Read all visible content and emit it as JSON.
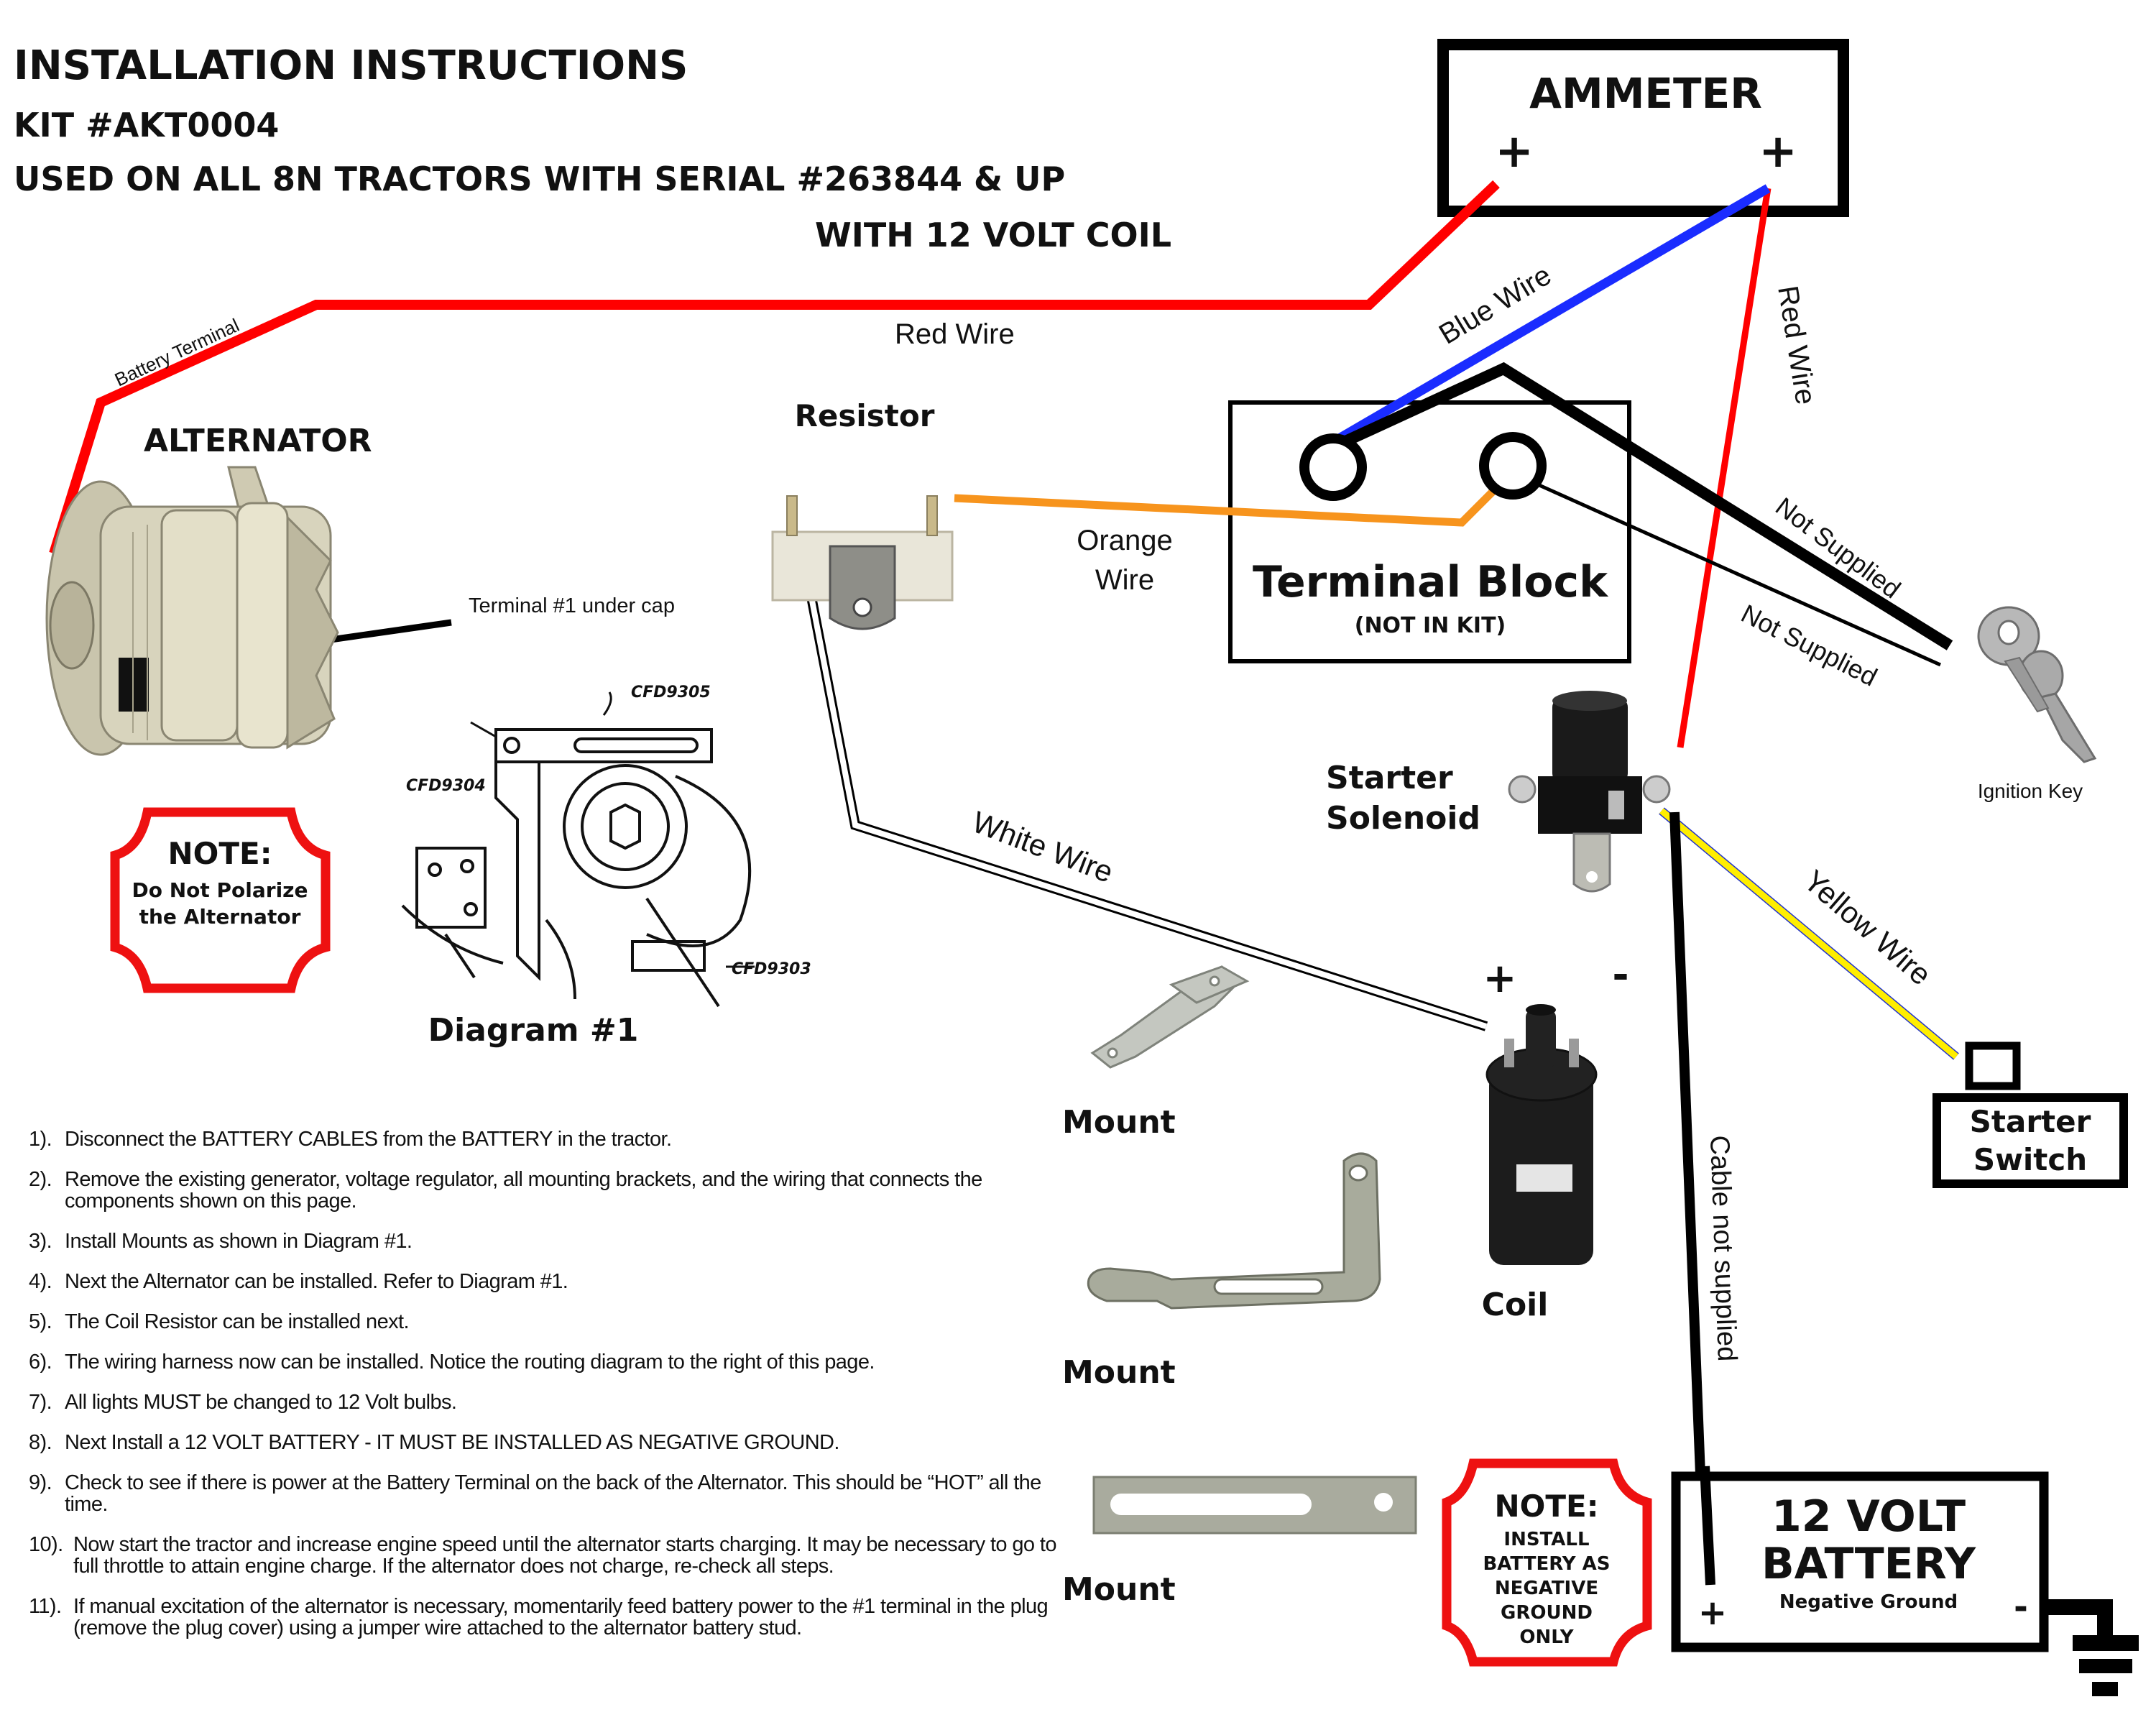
{
  "header": {
    "title": "INSTALLATION INSTRUCTIONS",
    "kit": "KIT #AKT0004",
    "applicability": "USED ON ALL 8N TRACTORS WITH SERIAL #263844 & UP",
    "coil_note": "WITH 12 VOLT COIL"
  },
  "colors": {
    "red_wire": "#ff0000",
    "blue_wire": "#1a2cff",
    "orange_wire": "#f7941d",
    "yellow_wire": "#ffee00",
    "black_wire": "#000000",
    "note_border": "#ee1111"
  },
  "components": {
    "ammeter": {
      "label": "AMMETER",
      "terminal_left": "+",
      "terminal_right": "+"
    },
    "alternator": {
      "label": "ALTERNATOR",
      "terminal_callout": "Terminal #1 under cap"
    },
    "resistor": {
      "label": "Resistor"
    },
    "terminal_block": {
      "label": "Terminal Block",
      "sublabel": "(NOT IN KIT)"
    },
    "starter_solenoid": {
      "line1": "Starter",
      "line2": "Solenoid"
    },
    "ignition_key": {
      "label": "Ignition Key"
    },
    "coil": {
      "label": "Coil",
      "plus": "+",
      "minus": "-"
    },
    "starter_switch": {
      "line1": "Starter",
      "line2": "Switch"
    },
    "battery": {
      "line1": "12 VOLT",
      "line2": "BATTERY",
      "sublabel": "Negative Ground",
      "plus": "+",
      "minus": "-"
    },
    "mounts": [
      {
        "label": "Mount"
      },
      {
        "label": "Mount"
      },
      {
        "label": "Mount"
      }
    ],
    "diagram": {
      "label": "Diagram #1",
      "parts": [
        "CFD9305",
        "CFD9304",
        "CFD9303"
      ]
    }
  },
  "wires": {
    "battery_terminal": "Battery Terminal",
    "red_top": "Red Wire",
    "red_right": "Red Wire",
    "blue": "Blue Wire",
    "orange_line1": "Orange",
    "orange_line2": "Wire",
    "white": "White Wire",
    "not_supplied_1": "Not Supplied",
    "not_supplied_2": "Not Supplied",
    "yellow": "Yellow Wire",
    "cable_not_supplied": "Cable not supplied"
  },
  "notes": [
    {
      "title": "NOTE:",
      "lines": [
        "Do Not Polarize",
        "the Alternator"
      ]
    },
    {
      "title": "NOTE:",
      "lines": [
        "INSTALL",
        "BATTERY AS",
        "NEGATIVE",
        "GROUND",
        "ONLY"
      ]
    }
  ],
  "instructions": [
    {
      "num": "1).",
      "text": "Disconnect the BATTERY CABLES from the BATTERY in the tractor."
    },
    {
      "num": "2).",
      "text": "Remove the existing generator, voltage regulator, all mounting brackets, and the wiring that connects the components shown on this page."
    },
    {
      "num": "3).",
      "text": "Install Mounts as shown in Diagram #1."
    },
    {
      "num": "4).",
      "text": "Next the Alternator can be installed. Refer to Diagram #1."
    },
    {
      "num": "5).",
      "text": "The Coil Resistor can be installed next."
    },
    {
      "num": "6).",
      "text": "The wiring harness now can be installed. Notice the routing diagram to the right of this page."
    },
    {
      "num": "7).",
      "text": "All lights MUST be changed to 12 Volt bulbs."
    },
    {
      "num": "8).",
      "text": "Next Install a 12 VOLT BATTERY - IT MUST BE INSTALLED AS NEGATIVE GROUND."
    },
    {
      "num": "9).",
      "text": "Check to see if there is power at the Battery Terminal on the back of the Alternator. This should be “HOT” all the time."
    },
    {
      "num": "10).",
      "text": "Now start the tractor and increase engine speed until the alternator starts charging. It may be necessary to go to full throttle to attain engine charge. If the alternator does not charge, re-check all steps."
    },
    {
      "num": "11).",
      "text": "If manual excitation of the alternator is necessary, momentarily feed battery power to the #1 terminal in the plug (remove the plug cover) using a jumper wire attached to the alternator battery stud."
    }
  ]
}
